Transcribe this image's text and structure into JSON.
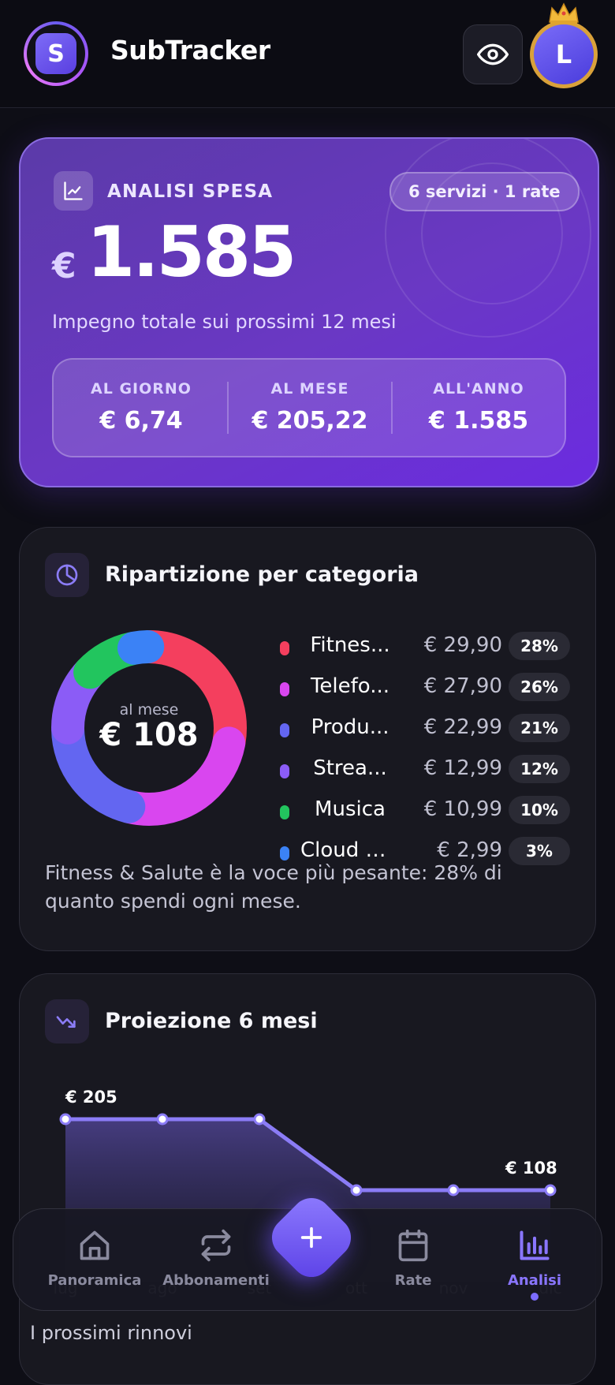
{
  "header": {
    "app_initial": "S",
    "app_title": "SubTracker",
    "user_initial": "L"
  },
  "hero": {
    "label": "ANALISI SPESA",
    "pill": "6 servizi · 1 rate",
    "currency": "€",
    "total": "1.585",
    "subtitle": "Impegno totale sui prossimi 12 mesi",
    "stats": [
      {
        "label": "AL GIORNO",
        "value": "€ 6,74"
      },
      {
        "label": "AL MESE",
        "value": "€ 205,22"
      },
      {
        "label": "ALL'ANNO",
        "value": "€ 1.585"
      }
    ]
  },
  "categories": {
    "title": "Ripartizione per categoria",
    "center_sub": "al mese",
    "center_value": "€ 108",
    "items": [
      {
        "name": "Fitness & Salute",
        "display": "Fitnes...",
        "amount": "€ 29,90",
        "percent": "28%",
        "share": 28,
        "color": "#f43f5e"
      },
      {
        "name": "Telefonia",
        "display": "Telefo...",
        "amount": "€ 27,90",
        "percent": "26%",
        "share": 26,
        "color": "#d946ef"
      },
      {
        "name": "Produttività",
        "display": "Produ...",
        "amount": "€ 22,99",
        "percent": "21%",
        "share": 21,
        "color": "#6366f1"
      },
      {
        "name": "Streaming",
        "display": "Strea...",
        "amount": "€ 12,99",
        "percent": "12%",
        "share": 12,
        "color": "#8b5cf6"
      },
      {
        "name": "Musica",
        "display": "Musica",
        "amount": "€ 10,99",
        "percent": "10%",
        "share": 10,
        "color": "#22c55e"
      },
      {
        "name": "Cloud & Storage",
        "display": "Cloud & ...",
        "amount": "€ 2,99",
        "percent": "3%",
        "share": 3,
        "color": "#3b82f6"
      }
    ],
    "insight": "Fitness & Salute è la voce più pesante: 28% di quanto spendi ogni mese."
  },
  "projection": {
    "title": "Proiezione 6 mesi",
    "start_label": "€ 205",
    "end_label": "€ 108",
    "chart_data": {
      "type": "area",
      "categories": [
        "lug",
        "ago",
        "set",
        "ott",
        "nov",
        "dic"
      ],
      "values": [
        205,
        205,
        205,
        108,
        108,
        108
      ],
      "color": "#8b7cf6"
    }
  },
  "next_section": "I prossimi rinnovi",
  "nav": {
    "items": [
      {
        "label": "Panoramica",
        "icon": "home-icon"
      },
      {
        "label": "Abbonamenti",
        "icon": "repeat-icon"
      },
      {
        "label": "Rate",
        "icon": "calendar-icon"
      },
      {
        "label": "Analisi",
        "icon": "bar-chart-icon"
      }
    ],
    "active": "Analisi",
    "accent": "#7c6cff"
  }
}
